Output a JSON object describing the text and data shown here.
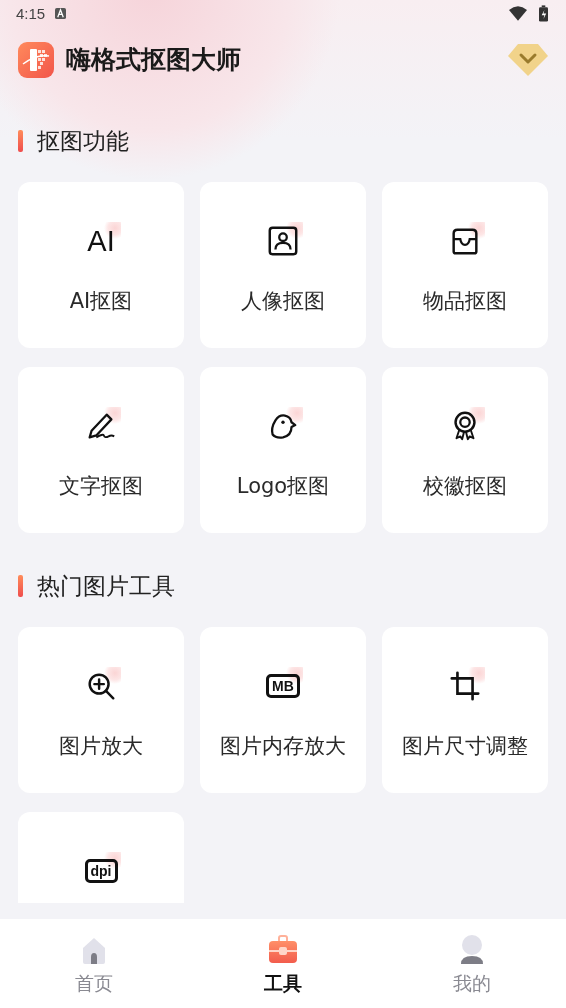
{
  "status_bar": {
    "time": "4:15"
  },
  "header": {
    "title": "嗨格式抠图大师"
  },
  "sections": [
    {
      "title": "抠图功能",
      "tools": [
        {
          "kind": "text",
          "icon_text": "AI",
          "label": "AI抠图"
        },
        {
          "kind": "portrait",
          "label": "人像抠图"
        },
        {
          "kind": "tray",
          "label": "物品抠图"
        },
        {
          "kind": "signature",
          "label": "文字抠图"
        },
        {
          "kind": "bird",
          "label": "Logo抠图"
        },
        {
          "kind": "badge",
          "label": "校徽抠图"
        }
      ]
    },
    {
      "title": "热门图片工具",
      "tools": [
        {
          "kind": "zoom",
          "label": "图片放大"
        },
        {
          "kind": "boxed_text",
          "icon_text": "MB",
          "label": "图片内存放大"
        },
        {
          "kind": "crop",
          "label": "图片尺寸调整"
        },
        {
          "kind": "boxed_text",
          "icon_text": "dpi"
        }
      ]
    }
  ],
  "nav": [
    {
      "kind": "home",
      "label": "首页",
      "selected": false
    },
    {
      "kind": "tools",
      "label": "工具",
      "selected": true
    },
    {
      "kind": "profile",
      "label": "我的",
      "selected": false
    }
  ]
}
